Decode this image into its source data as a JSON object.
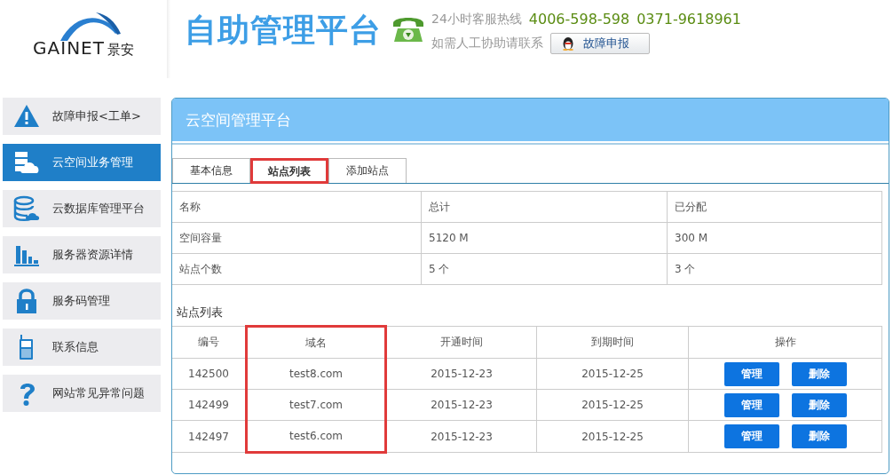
{
  "header": {
    "logo_text": "GAINET",
    "logo_cn": "景安",
    "title": "自助管理平台",
    "hotline_label": "24小时客服热线",
    "hotline_numbers": [
      "4006-598-598",
      "0371-9618961"
    ],
    "help_text": "如需人工协助请联系",
    "help_button": "故障申报"
  },
  "sidebar": {
    "items": [
      {
        "label": "故障申报<工单>",
        "kind": "warning",
        "selected": false
      },
      {
        "label": "云空间业务管理",
        "kind": "cloud-server",
        "selected": true
      },
      {
        "label": "云数据库管理平台",
        "kind": "database",
        "selected": false
      },
      {
        "label": "服务器资源详情",
        "kind": "chart",
        "selected": false
      },
      {
        "label": "服务码管理",
        "kind": "lock",
        "selected": false
      },
      {
        "label": "联系信息",
        "kind": "phone",
        "selected": false
      },
      {
        "label": "网站常见异常问题",
        "kind": "question",
        "selected": false
      }
    ]
  },
  "panel": {
    "title": "云空间管理平台",
    "tabs": [
      {
        "label": "基本信息",
        "selected": false,
        "highlighted": false
      },
      {
        "label": "站点列表",
        "selected": true,
        "highlighted": true
      },
      {
        "label": "添加站点",
        "selected": false,
        "highlighted": false
      }
    ],
    "summary_table": {
      "rows": [
        [
          "名称",
          "总计",
          "已分配"
        ],
        [
          "空间容量",
          "5120  M",
          "300  M"
        ],
        [
          "站点个数",
          "5 个",
          "3 个"
        ]
      ]
    },
    "section_title": "站点列表",
    "site_table": {
      "columns": [
        {
          "label": "编号",
          "highlighted": false
        },
        {
          "label": "域名",
          "highlighted": true
        },
        {
          "label": "开通时间",
          "highlighted": false
        },
        {
          "label": "到期时间",
          "highlighted": false
        },
        {
          "label": "操作",
          "highlighted": false
        }
      ],
      "rows": [
        {
          "cells": [
            "142500",
            "test8.com",
            "2015-12-23",
            "2015-12-25"
          ],
          "actions": [
            "管理",
            "删除"
          ]
        },
        {
          "cells": [
            "142499",
            "test7.com",
            "2015-12-23",
            "2015-12-25"
          ],
          "actions": [
            "管理",
            "删除"
          ]
        },
        {
          "cells": [
            "142497",
            "test6.com",
            "2015-12-23",
            "2015-12-25"
          ],
          "actions": [
            "管理",
            "删除"
          ]
        }
      ]
    }
  }
}
